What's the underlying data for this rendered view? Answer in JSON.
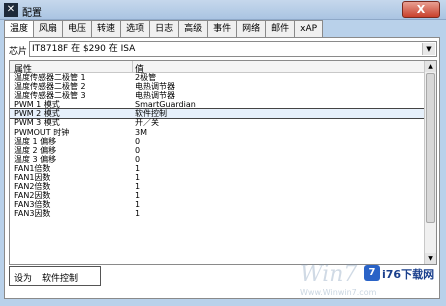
{
  "window": {
    "title": "配置",
    "close_label": "X",
    "app_icon_glyph": "✕"
  },
  "tabs": [
    {
      "label": "温度",
      "active": true
    },
    {
      "label": "风扇",
      "active": false
    },
    {
      "label": "电压",
      "active": false
    },
    {
      "label": "转速",
      "active": false
    },
    {
      "label": "选项",
      "active": false
    },
    {
      "label": "日志",
      "active": false
    },
    {
      "label": "高级",
      "active": false
    },
    {
      "label": "事件",
      "active": false
    },
    {
      "label": "网络",
      "active": false
    },
    {
      "label": "邮件",
      "active": false
    },
    {
      "label": "xAP",
      "active": false
    }
  ],
  "chip": {
    "label": "芯片",
    "value": "IT8718F 在 $290 在 ISA"
  },
  "grid": {
    "headers": {
      "property": "属性",
      "value": "值"
    },
    "rows": [
      {
        "property": "温度传感器二极管 1",
        "value": "2极管"
      },
      {
        "property": "温度传感器二极管 2",
        "value": "电热调节器"
      },
      {
        "property": "温度传感器二极管 3",
        "value": "电热调节器"
      },
      {
        "property": "PWM 1 模式",
        "value": "SmartGuardian"
      },
      {
        "property": "PWM 2 模式",
        "value": "软件控制",
        "selected": true
      },
      {
        "property": "PWM 3 模式",
        "value": "开／关"
      },
      {
        "property": "PWMOUT 时钟",
        "value": "3M"
      },
      {
        "property": "温度 1 偏移",
        "value": "0"
      },
      {
        "property": "温度 2 偏移",
        "value": "0"
      },
      {
        "property": "温度 3 偏移",
        "value": "0"
      },
      {
        "property": "FAN1倍数",
        "value": "1"
      },
      {
        "property": "FAN1因数",
        "value": "1"
      },
      {
        "property": "FAN2倍数",
        "value": "1"
      },
      {
        "property": "FAN2因数",
        "value": "1"
      },
      {
        "property": "FAN3倍数",
        "value": "1"
      },
      {
        "property": "FAN3因数",
        "value": "1"
      }
    ]
  },
  "set_as": {
    "label": "设为",
    "value": "软件控制"
  },
  "watermarks": {
    "win": "Win7",
    "site": "Www.Winwin7.com",
    "logo_glyph": "7",
    "brand": "i76下载网"
  }
}
